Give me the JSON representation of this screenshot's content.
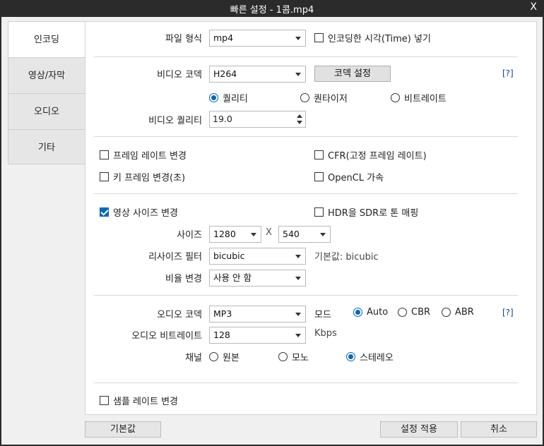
{
  "window": {
    "title": "빠른 설정 - 1콤.mp4",
    "close": "X"
  },
  "tabs": [
    {
      "label": "인코딩",
      "active": true
    },
    {
      "label": "영상/자막",
      "active": false
    },
    {
      "label": "오디오",
      "active": false
    },
    {
      "label": "기타",
      "active": false
    }
  ],
  "file_format": {
    "label": "파일 형식",
    "value": "mp4"
  },
  "encode_time": {
    "label": "인코딩한 시각(Time) 넣기",
    "checked": false
  },
  "video_codec": {
    "label": "비디오 코덱",
    "value": "H264",
    "settings_button": "코덱 설정",
    "help": "[?]"
  },
  "rate_mode": {
    "options": [
      {
        "label": "퀄리티",
        "selected": true
      },
      {
        "label": "퀀타이저",
        "selected": false
      },
      {
        "label": "비트레이트",
        "selected": false
      }
    ]
  },
  "video_quality": {
    "label": "비디오 퀄리티",
    "value": "19.0"
  },
  "frame_rate_change": {
    "label": "프레임 레이트 변경",
    "checked": false
  },
  "cfr": {
    "label": "CFR(고정 프레임 레이트)",
    "checked": false
  },
  "keyframe_change": {
    "label": "키 프레임 변경(초)",
    "checked": false
  },
  "opencl": {
    "label": "OpenCL 가속",
    "checked": false
  },
  "resize": {
    "label": "영상 사이즈 변경",
    "checked": true
  },
  "hdr_tonemap": {
    "label": "HDR을 SDR로 톤 매핑",
    "checked": false
  },
  "size": {
    "label": "사이즈",
    "width": "1280",
    "x": "X",
    "height": "540"
  },
  "resize_filter": {
    "label": "리사이즈 필터",
    "value": "bicubic",
    "default_text": "기본값: bicubic"
  },
  "aspect": {
    "label": "비율 변경",
    "value": "사용 안 함"
  },
  "audio_codec": {
    "label": "오디오 코덱",
    "value": "MP3",
    "mode_label": "모드",
    "help": "[?]"
  },
  "audio_mode": {
    "options": [
      {
        "label": "Auto",
        "selected": true
      },
      {
        "label": "CBR",
        "selected": false
      },
      {
        "label": "ABR",
        "selected": false
      }
    ]
  },
  "audio_bitrate": {
    "label": "오디오 비트레이트",
    "value": "128",
    "unit": "Kbps"
  },
  "channel": {
    "label": "채널",
    "options": [
      {
        "label": "원본",
        "selected": false
      },
      {
        "label": "모노",
        "selected": false
      },
      {
        "label": "스테레오",
        "selected": true
      }
    ]
  },
  "sample_rate_change": {
    "label": "샘플 레이트 변경",
    "checked": false
  },
  "footer": {
    "default": "기본값",
    "apply": "설정 적용",
    "cancel": "취소"
  },
  "colors": {
    "accent": "#0067c0",
    "titlebar": "#2b2b2b",
    "link": "#0b3fa8"
  }
}
